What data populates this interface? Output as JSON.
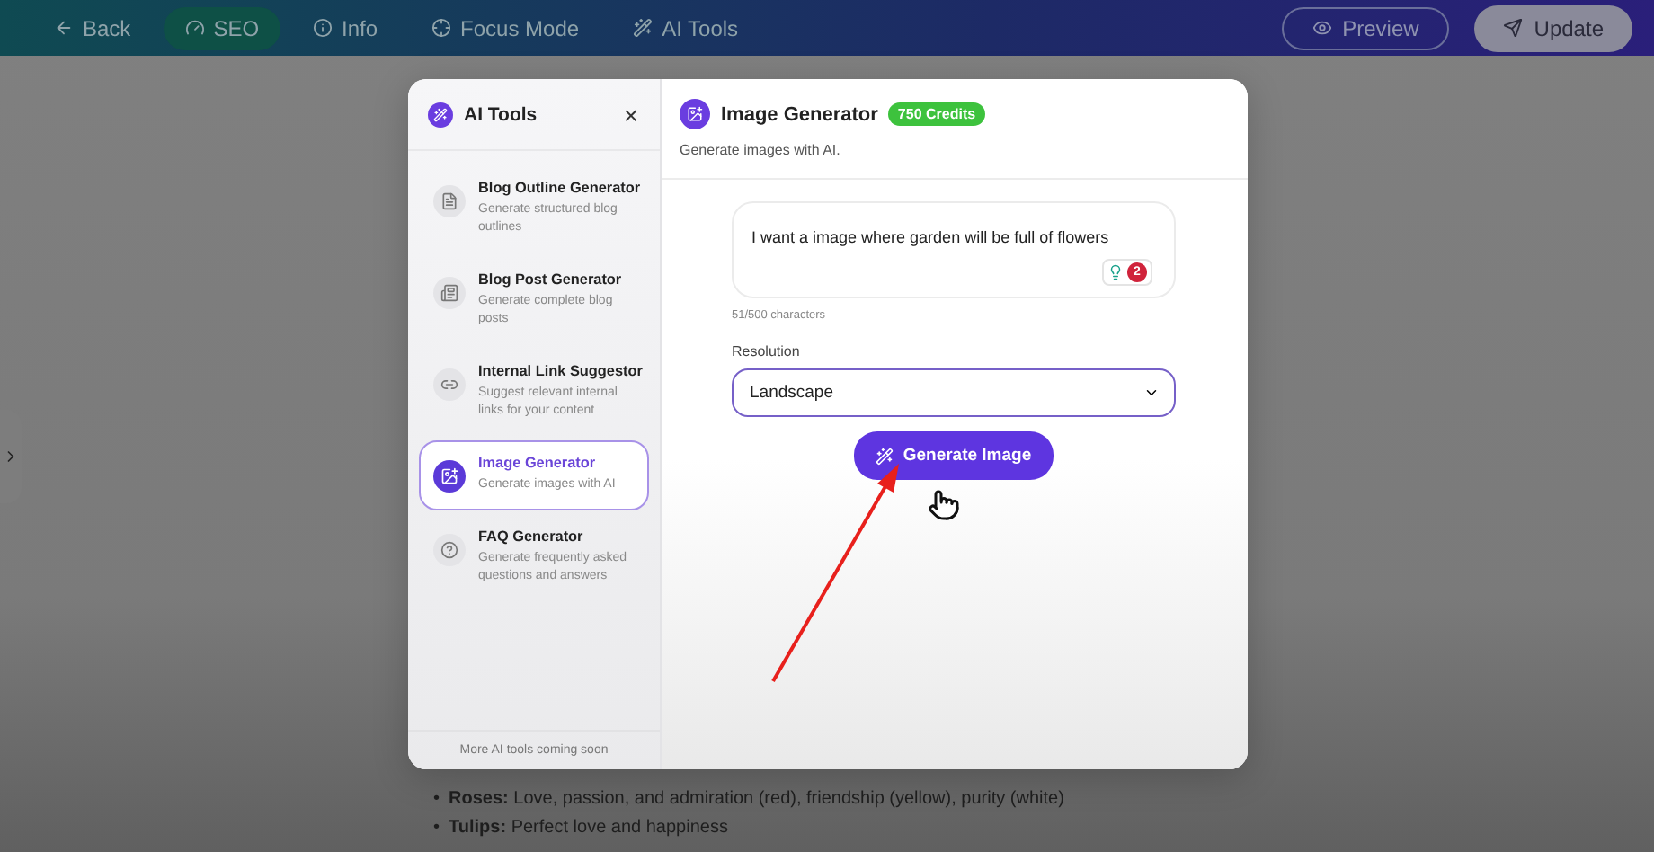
{
  "top_bar": {
    "back": "Back",
    "tabs": [
      {
        "label": "SEO",
        "selected": true
      },
      {
        "label": "Info",
        "selected": false
      },
      {
        "label": "Focus Mode",
        "selected": false
      },
      {
        "label": "AI Tools",
        "selected": false
      }
    ],
    "preview": "Preview",
    "update": "Update"
  },
  "modal": {
    "sidebar": {
      "title": "AI Tools",
      "close": "×",
      "tools": [
        {
          "name": "Blog Outline Generator",
          "description": "Generate structured blog outlines",
          "selected": false
        },
        {
          "name": "Blog Post Generator",
          "description": "Generate complete blog posts",
          "selected": false
        },
        {
          "name": "Internal Link Suggestor",
          "description": "Suggest relevant internal links for your content",
          "selected": false
        },
        {
          "name": "Image Generator",
          "description": "Generate images with AI",
          "selected": true
        },
        {
          "name": "FAQ Generator",
          "description": "Generate frequently asked questions and answers",
          "selected": false
        }
      ],
      "footer": "More AI tools coming soon"
    },
    "main": {
      "title": "Image Generator",
      "credits": "750 Credits",
      "subtitle": "Generate images with AI.",
      "prompt": "I want a image where garden will be full of flowers",
      "issues": "2",
      "char_count": "51/500 characters",
      "resolution_label": "Resolution",
      "resolution": "Landscape",
      "button": "Generate Image"
    }
  },
  "content": {
    "bullets": [
      {
        "marker": "•",
        "term": "Roses:",
        "text": "Love, passion, and admiration (red), friendship (yellow), purity (white)"
      },
      {
        "marker": "•",
        "term": "Tulips:",
        "text": "Perfect love and happiness"
      }
    ]
  }
}
